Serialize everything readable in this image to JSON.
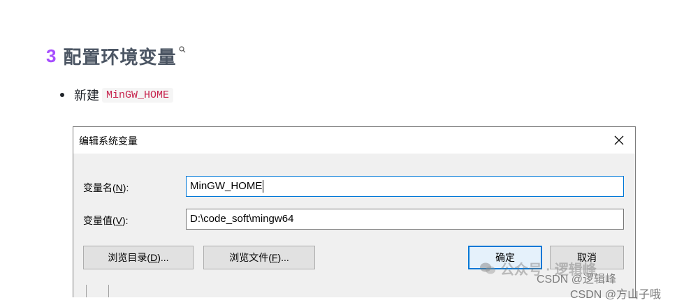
{
  "heading": {
    "number": "3",
    "title": "配置环境变量"
  },
  "bullet": {
    "text": "新建",
    "code": "MinGW_HOME"
  },
  "dialog": {
    "title": "编辑系统变量",
    "name_label_prefix": "变量名(",
    "name_label_key": "N",
    "name_label_suffix": "):",
    "name_value": "MinGW_HOME",
    "value_label_prefix": "变量值(",
    "value_label_key": "V",
    "value_label_suffix": "):",
    "value_value": "D:\\code_soft\\mingw64",
    "browse_dir_prefix": "浏览目录(",
    "browse_dir_key": "D",
    "browse_dir_suffix": ")...",
    "browse_file_prefix": "浏览文件(",
    "browse_file_key": "F",
    "browse_file_suffix": ")...",
    "ok_label": "确定",
    "cancel_label": "取消"
  },
  "watermarks": {
    "wechat": "公众号 · 逻辑峰",
    "csdn1": "CSDN @逻辑峰",
    "csdn2": "CSDN @方山子哦"
  },
  "colors": {
    "accent": "#a64dff",
    "focus": "#0078d7",
    "code": "#c7254e"
  }
}
